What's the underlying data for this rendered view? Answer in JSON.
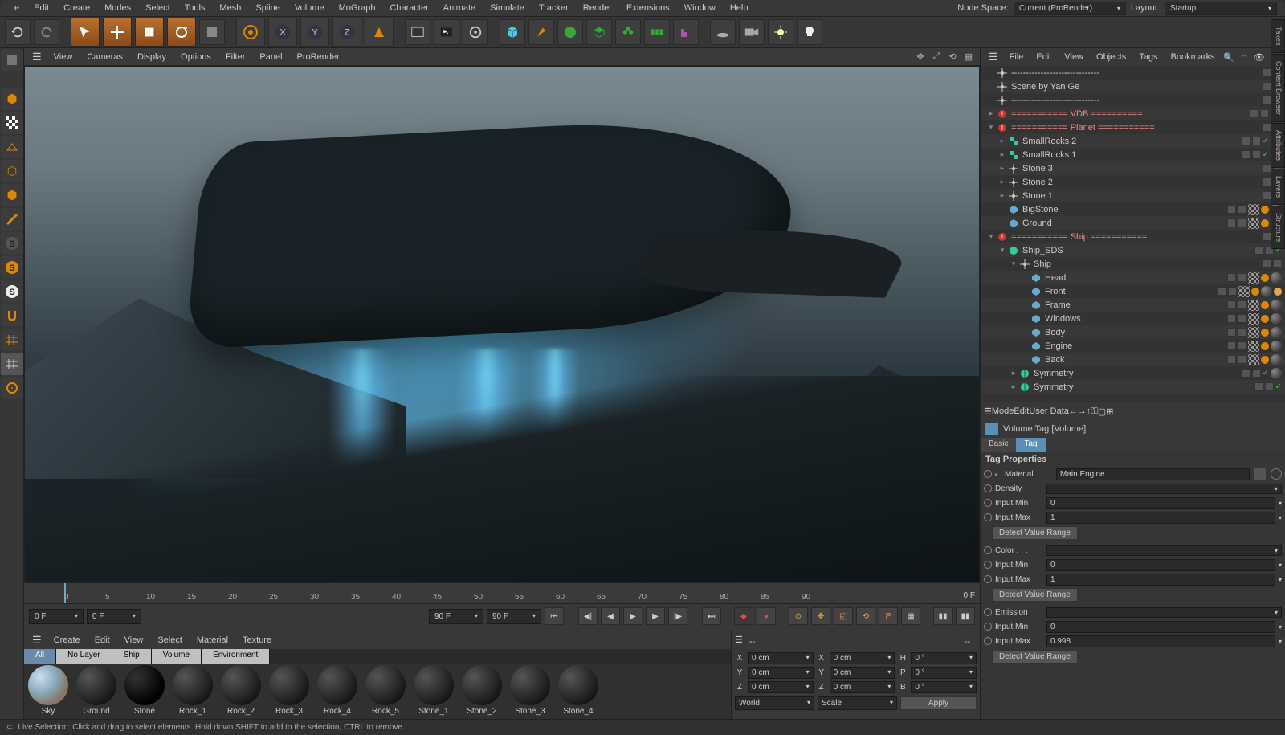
{
  "menubar": {
    "items": [
      "e",
      "Edit",
      "Create",
      "Modes",
      "Select",
      "Tools",
      "Mesh",
      "Spline",
      "Volume",
      "MoGraph",
      "Character",
      "Animate",
      "Simulate",
      "Tracker",
      "Render",
      "Extensions",
      "Window",
      "Help"
    ],
    "nodespace_label": "Node Space:",
    "nodespace_value": "Current (ProRender)",
    "layout_label": "Layout:",
    "layout_value": "Startup"
  },
  "viewport_menu": {
    "items": [
      "View",
      "Cameras",
      "Display",
      "Options",
      "Filter",
      "Panel",
      "ProRender"
    ]
  },
  "timeline": {
    "ticks": [
      "0",
      "5",
      "10",
      "15",
      "20",
      "25",
      "30",
      "35",
      "40",
      "45",
      "50",
      "55",
      "60",
      "65",
      "70",
      "75",
      "80",
      "85",
      "90"
    ],
    "end": "0 F",
    "start_field": "0 F",
    "cur_field": "0 F",
    "range_end": "90 F",
    "range_end2": "90 F"
  },
  "material_menu": {
    "items": [
      "Create",
      "Edit",
      "View",
      "Select",
      "Material",
      "Texture"
    ]
  },
  "material_tabs": [
    "All",
    "No Layer",
    "Ship",
    "Volume",
    "Environment"
  ],
  "materials": [
    {
      "name": "Sky",
      "style": "sky"
    },
    {
      "name": "Ground",
      "style": "d"
    },
    {
      "name": "Stone",
      "style": "dark"
    },
    {
      "name": "Rock_1",
      "style": "d"
    },
    {
      "name": "Rock_2",
      "style": "d"
    },
    {
      "name": "Rock_3",
      "style": "d"
    },
    {
      "name": "Rock_4",
      "style": "d"
    },
    {
      "name": "Rock_5",
      "style": "d"
    },
    {
      "name": "Stone_1",
      "style": "d"
    },
    {
      "name": "Stone_2",
      "style": "d"
    },
    {
      "name": "Stone_3",
      "style": "d"
    },
    {
      "name": "Stone_4",
      "style": "d"
    }
  ],
  "coords": {
    "x": "0 cm",
    "y": "0 cm",
    "z": "0 cm",
    "x2": "0 cm",
    "y2": "0 cm",
    "z2": "0 cm",
    "h": "0 °",
    "p": "0 °",
    "b": "0 °",
    "mode1": "World",
    "mode2": "Scale",
    "apply": "Apply",
    "dash": "--"
  },
  "obj_menu": {
    "items": [
      "File",
      "Edit",
      "View",
      "Objects",
      "Tags",
      "Bookmarks"
    ]
  },
  "tree": [
    {
      "d": 0,
      "t": "null",
      "n": "------------------------------",
      "e": ""
    },
    {
      "d": 0,
      "t": "null",
      "n": "Scene by Yan Ge",
      "e": ""
    },
    {
      "d": 0,
      "t": "null",
      "n": "------------------------------",
      "e": ""
    },
    {
      "d": 0,
      "t": "red",
      "n": "=========== VDB ==========",
      "e": "+",
      "tags": [
        "orange"
      ]
    },
    {
      "d": 0,
      "t": "red",
      "n": "=========== Planet ===========",
      "e": "-"
    },
    {
      "d": 1,
      "t": "clone",
      "n": "SmallRocks 2",
      "e": "+",
      "tags": [
        "chk",
        "sphere"
      ]
    },
    {
      "d": 1,
      "t": "clone",
      "n": "SmallRocks 1",
      "e": "+",
      "tags": [
        "chk",
        "sphere"
      ]
    },
    {
      "d": 1,
      "t": "null",
      "n": "Stone 3",
      "e": "+"
    },
    {
      "d": 1,
      "t": "null",
      "n": "Stone 2",
      "e": "+"
    },
    {
      "d": 1,
      "t": "null",
      "n": "Stone 1",
      "e": "+"
    },
    {
      "d": 1,
      "t": "poly",
      "n": "BigStone",
      "e": "",
      "tags": [
        "checker",
        "dot",
        "sphere"
      ]
    },
    {
      "d": 1,
      "t": "poly",
      "n": "Ground",
      "e": "",
      "tags": [
        "checker",
        "dot",
        "sphere"
      ]
    },
    {
      "d": 0,
      "t": "red",
      "n": "=========== Ship ===========",
      "e": "-"
    },
    {
      "d": 1,
      "t": "sds",
      "n": "Ship_SDS",
      "e": "-",
      "tags": [
        "chk"
      ]
    },
    {
      "d": 2,
      "t": "null",
      "n": "Ship",
      "e": "-"
    },
    {
      "d": 3,
      "t": "poly",
      "n": "Head",
      "e": "",
      "tags": [
        "checker",
        "dot",
        "sphere"
      ]
    },
    {
      "d": 3,
      "t": "poly",
      "n": "Front",
      "e": "",
      "tags": [
        "checker",
        "dot",
        "sphere",
        "extra"
      ]
    },
    {
      "d": 3,
      "t": "poly",
      "n": "Frame",
      "e": "",
      "tags": [
        "checker",
        "dot",
        "sphere"
      ]
    },
    {
      "d": 3,
      "t": "poly",
      "n": "Windows",
      "e": "",
      "tags": [
        "checker",
        "dot",
        "sphere"
      ]
    },
    {
      "d": 3,
      "t": "poly",
      "n": "Body",
      "e": "",
      "tags": [
        "checker",
        "dot",
        "sphere"
      ]
    },
    {
      "d": 3,
      "t": "poly",
      "n": "Engine",
      "e": "",
      "tags": [
        "checker",
        "dot",
        "sphere"
      ]
    },
    {
      "d": 3,
      "t": "poly",
      "n": "Back",
      "e": "",
      "tags": [
        "checker",
        "dot",
        "sphere"
      ]
    },
    {
      "d": 2,
      "t": "sym",
      "n": "Symmetry",
      "e": "+",
      "tags": [
        "chk",
        "sphere"
      ]
    },
    {
      "d": 2,
      "t": "sym",
      "n": "Symmetry",
      "e": "+",
      "tags": [
        "chk"
      ]
    }
  ],
  "attr_menu": {
    "items": [
      "Mode",
      "Edit",
      "User Data"
    ]
  },
  "attr_header": "Volume Tag [Volume]",
  "attr_tabs": {
    "basic": "Basic",
    "tag": "Tag"
  },
  "attr_section": "Tag Properties",
  "props": {
    "material_lbl": "Material",
    "material_val": "Main Engine",
    "density_lbl": "Density",
    "inputmin_lbl": "Input Min",
    "inputmax_lbl": "Input Max",
    "inmin1": "0",
    "inmax1": "1",
    "detect": "Detect Value Range",
    "color_lbl": "Color . . .",
    "inmin2": "0",
    "inmax2": "1",
    "emission_lbl": "Emission",
    "inmin3": "0",
    "inmax3": "0.998"
  },
  "side_tabs": [
    "Takes",
    "Content Browser",
    "Attributes",
    "Layers",
    "Structure"
  ],
  "status": "Live Selection: Click and drag to select elements. Hold down SHIFT to add to the selection, CTRL to remove."
}
